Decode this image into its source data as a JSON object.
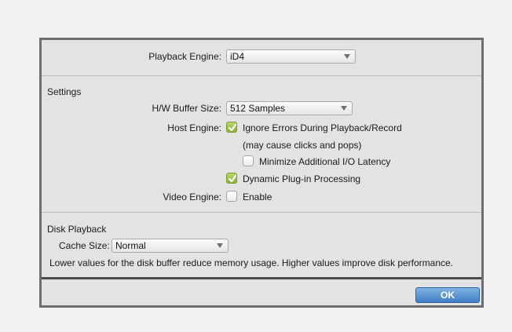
{
  "playback": {
    "label": "Playback Engine:",
    "value": "iD4"
  },
  "settings": {
    "section_title": "Settings",
    "hw_buffer": {
      "label": "H/W Buffer Size:",
      "value": "512 Samples"
    },
    "host_engine": {
      "label": "Host Engine:",
      "ignore_errors": {
        "label": "Ignore Errors During Playback/Record",
        "checked": true
      },
      "ignore_note": "(may cause clicks and pops)",
      "minimize_latency": {
        "label": "Minimize Additional I/O Latency",
        "checked": false
      },
      "dynamic_plugin": {
        "label": "Dynamic Plug-in Processing",
        "checked": true
      }
    },
    "video_engine": {
      "label": "Video Engine:",
      "enable_label": "Enable",
      "checked": false
    }
  },
  "disk": {
    "section_title": "Disk Playback",
    "cache_label": "Cache Size:",
    "cache_value": "Normal",
    "description": "Lower values for the disk buffer reduce memory usage.  Higher values improve disk performance."
  },
  "footer": {
    "ok_label": "OK"
  },
  "colors": {
    "accent_button": "#3f7fc4",
    "checkbox_checked": "#8cb23a",
    "panel_bg": "#e3e3e3",
    "border": "#6e6e6e"
  },
  "icons": {
    "caret": "chevron-down-icon",
    "check": "checkmark-icon"
  }
}
